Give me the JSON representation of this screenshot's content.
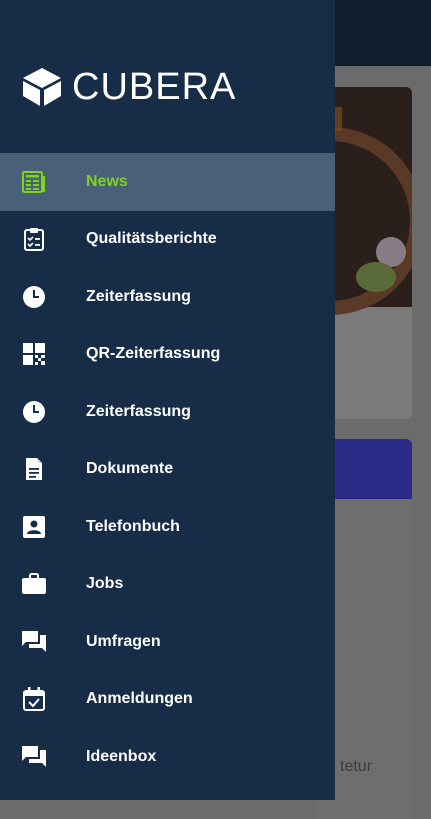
{
  "app": {
    "brand": "CUBERA"
  },
  "menu": {
    "items": [
      {
        "label": "News",
        "icon": "newspaper-icon",
        "active": true
      },
      {
        "label": "Qualitätsberichte",
        "icon": "clipboard-check-icon"
      },
      {
        "label": "Zeiterfassung",
        "icon": "clock-icon"
      },
      {
        "label": "QR-Zeiterfassung",
        "icon": "qr-code-icon"
      },
      {
        "label": "Zeiterfassung",
        "icon": "clock-icon"
      },
      {
        "label": "Dokumente",
        "icon": "document-icon"
      },
      {
        "label": "Telefonbuch",
        "icon": "contact-card-icon"
      },
      {
        "label": "Jobs",
        "icon": "briefcase-icon"
      },
      {
        "label": "Umfragen",
        "icon": "chat-bubbles-icon"
      },
      {
        "label": "Anmeldungen",
        "icon": "calendar-check-icon"
      },
      {
        "label": "Ideenbox",
        "icon": "chat-bubbles-icon"
      }
    ]
  },
  "background": {
    "partial_text": "tetur"
  },
  "colors": {
    "drawer": "#172c47",
    "active_row": "#4a6078",
    "active_text": "#7ed321",
    "text": "#ffffff"
  }
}
